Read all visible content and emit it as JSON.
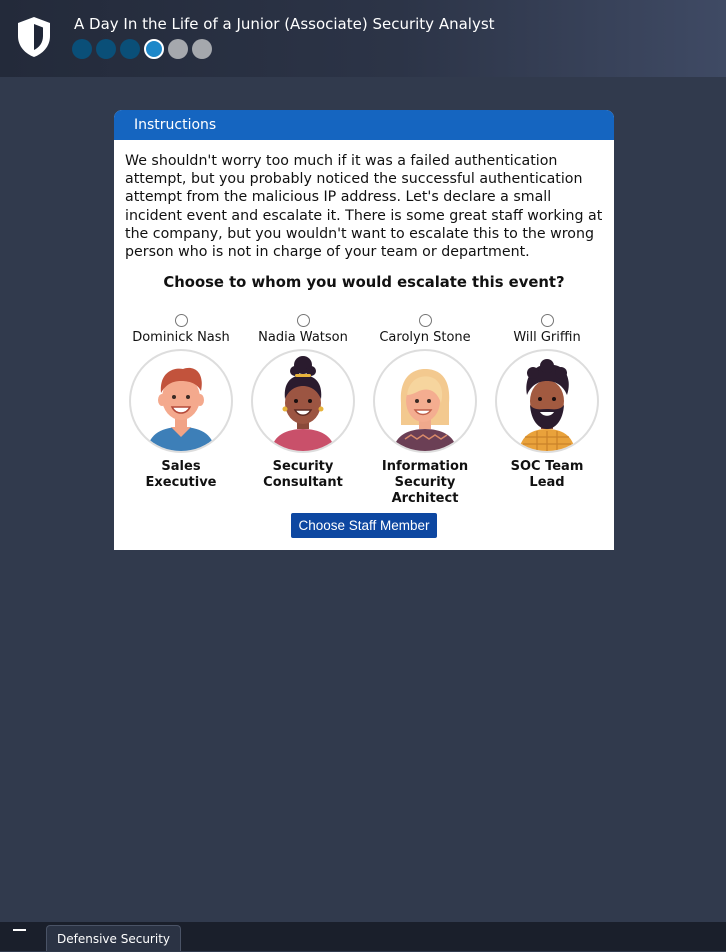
{
  "header": {
    "title": "A Day In the Life of a Junior (Associate) Security Analyst",
    "logo_icon": "shield-icon",
    "progress": {
      "total_steps": 6,
      "current_step": 4
    }
  },
  "panel": {
    "heading": "Instructions",
    "text": "We shouldn't worry too much if it was a failed authentication attempt, but you probably noticed the successful authentication attempt from the malicious IP address. Let's declare a small incident event and escalate it. There is some great staff working at the company, but you wouldn't want to escalate this to the wrong person who is not in charge of your team or department.",
    "question": "Choose to whom you would escalate this event?",
    "staff": [
      {
        "name": "Dominick Nash",
        "role": "Sales Executive",
        "selected": false
      },
      {
        "name": "Nadia Watson",
        "role": "Security Consultant",
        "selected": false
      },
      {
        "name": "Carolyn Stone",
        "role": "Information Security Architect",
        "selected": false
      },
      {
        "name": "Will Griffin",
        "role": "SOC Team Lead",
        "selected": false
      }
    ],
    "button_label": "Choose Staff Member"
  },
  "taskbar": {
    "tab_label": "Defensive Security"
  },
  "colors": {
    "background": "#313a4d",
    "panel_header": "#1565c0",
    "button": "#0d47a1",
    "progress_done": "#0a4f78",
    "progress_current": "#1e88c9",
    "progress_todo": "#a5a8ad"
  }
}
